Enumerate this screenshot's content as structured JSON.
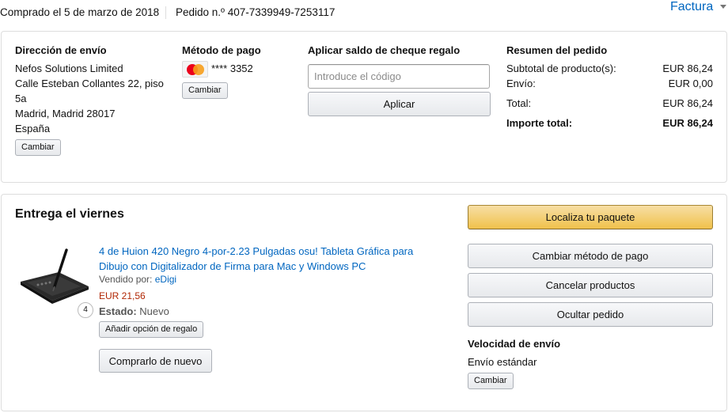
{
  "header": {
    "purchased": "Comprado el 5 de marzo de 2018",
    "order_number": "Pedido n.º 407-7339949-7253117",
    "invoice": "Factura"
  },
  "shipping": {
    "title": "Dirección de envío",
    "lines": [
      "Nefos Solutions Limited",
      "Calle Esteban Collantes 22, piso",
      "5a",
      "Madrid, Madrid 28017",
      "España"
    ],
    "change": "Cambiar"
  },
  "payment": {
    "title": "Método de pago",
    "card_masked": "**** 3352",
    "card_icon": "mastercard-icon",
    "change": "Cambiar"
  },
  "gift": {
    "title": "Aplicar saldo de cheque regalo",
    "placeholder": "Introduce el código",
    "apply": "Aplicar"
  },
  "summary": {
    "title": "Resumen del pedido",
    "rows": [
      {
        "label": "Subtotal de producto(s):",
        "value": "EUR 86,24"
      },
      {
        "label": "Envío:",
        "value": "EUR 0,00"
      },
      {
        "label": "Total:",
        "value": "EUR 86,24"
      },
      {
        "label": "Importe total:",
        "value": "EUR 86,24"
      }
    ]
  },
  "delivery": {
    "title": "Entrega el viernes",
    "product": {
      "name": "4 de Huion 420 Negro 4-por-2.23 Pulgadas osu! Tableta Gráfica para Dibujo con Digitalizador de Firma para Mac y Windows PC",
      "sold_by_label": "Vendido por:",
      "seller": "eDigi",
      "price": "EUR 21,56",
      "state_label": "Estado:",
      "state": "Nuevo",
      "quantity": "4",
      "gift_option": "Añadir opción de regalo",
      "buy_again": "Comprarlo de nuevo"
    },
    "actions": {
      "track": "Localiza tu paquete",
      "change_payment": "Cambiar método de pago",
      "cancel": "Cancelar productos",
      "hide": "Ocultar pedido"
    },
    "speed": {
      "title": "Velocidad de envío",
      "value": "Envío estándar",
      "change": "Cambiar"
    }
  },
  "colors": {
    "link": "#0066c0",
    "price": "#b12704",
    "primary_button": "#f0c14b"
  }
}
